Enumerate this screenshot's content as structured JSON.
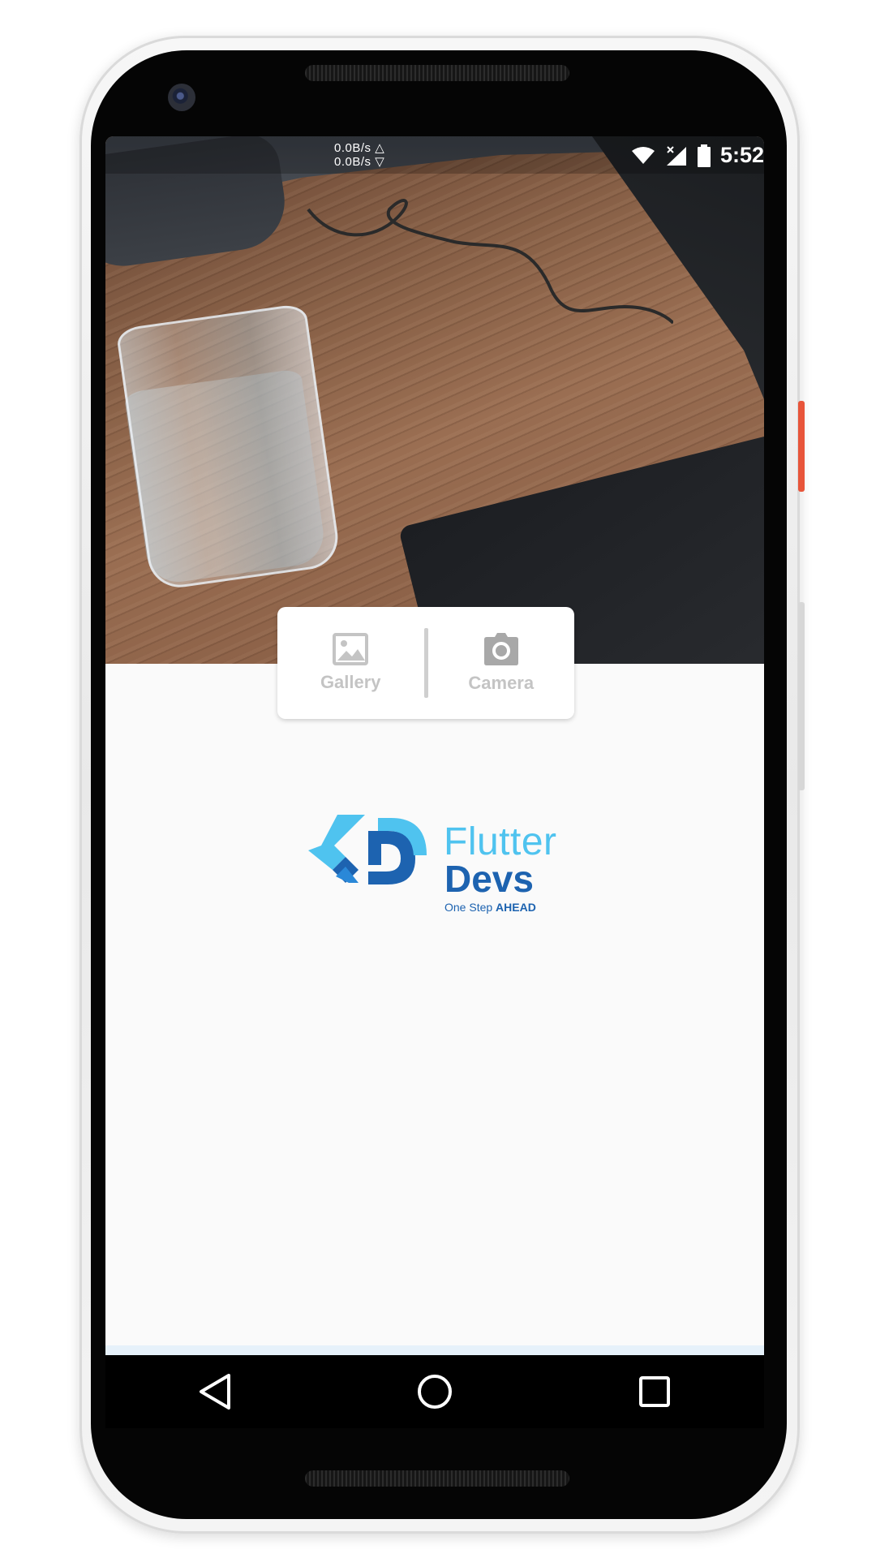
{
  "status_bar": {
    "upload_speed": "0.0B/s △",
    "download_speed": "0.0B/s ▽",
    "time": "5:52",
    "icons": [
      "wifi-icon",
      "signal-icon",
      "battery-icon"
    ]
  },
  "photo": {
    "alt": "Selected photo of a glass of water on a wooden table"
  },
  "picker": {
    "gallery_label": "Gallery",
    "gallery_icon": "image-icon",
    "camera_label": "Camera",
    "camera_icon": "camera-icon"
  },
  "logo": {
    "line1": "Flutter",
    "line2": "Devs",
    "tagline_prefix": "One Step",
    "tagline_emphasis": "AHEAD",
    "colors": {
      "light": "#4fc3ef",
      "dark": "#1d63b0"
    }
  },
  "nav_bar": {
    "buttons": [
      "back-icon",
      "home-icon",
      "recents-icon"
    ]
  },
  "colors": {
    "screen_background": "#fafafa",
    "power_button": "#e8553a",
    "picker_text": "#c4c4c4"
  }
}
